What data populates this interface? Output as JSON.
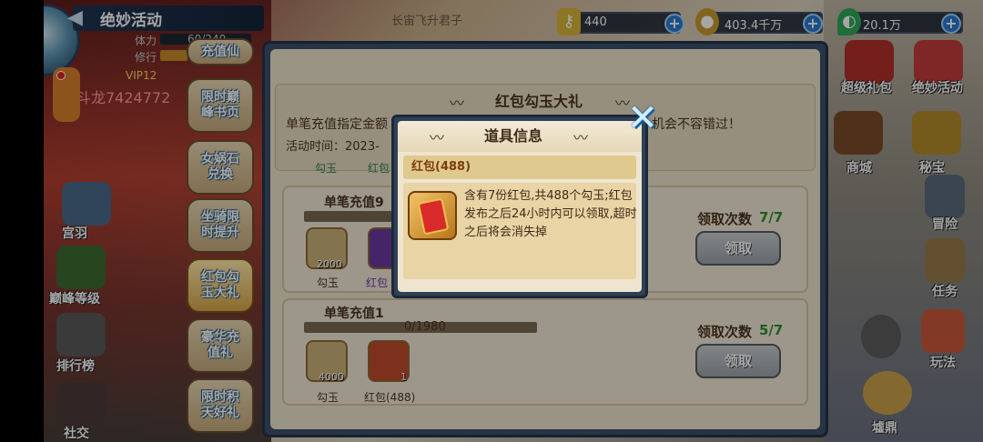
{
  "header": {
    "title": "绝妙活动",
    "stamina_label": "体力",
    "stamina_value": "60/240",
    "cultivation_label": "修行",
    "player_id": "斗龙7424772",
    "vip": "VIP12"
  },
  "resources": [
    {
      "icon": "key-icon",
      "value": "440"
    },
    {
      "icon": "coin-icon",
      "value": "403.4千万"
    },
    {
      "icon": "jade-icon",
      "value": "20.1万"
    }
  ],
  "top_center_text": "长宙飞升君子",
  "nav": {
    "items": [
      {
        "label": "限时巅峰书页"
      },
      {
        "label": "女娲石兑换"
      },
      {
        "label": "坐骑限时提升"
      },
      {
        "label": "红包勾玉大礼"
      },
      {
        "label": "豪华充值礼"
      },
      {
        "label": "限时积天好礼"
      }
    ],
    "top_partial": "充值仙"
  },
  "left_side": [
    {
      "label": "宫羽"
    },
    {
      "label": "巅峰等级"
    },
    {
      "label": "排行榜"
    },
    {
      "label": "社交"
    }
  ],
  "right_side": [
    {
      "label": "超级礼包"
    },
    {
      "label": "绝妙活动"
    },
    {
      "label": "商城"
    },
    {
      "label": "秘宝"
    },
    {
      "label": "冒险"
    },
    {
      "label": "任务"
    },
    {
      "label": "玩法"
    },
    {
      "label": "墟鼎"
    }
  ],
  "panel": {
    "title": "红包勾玉大礼",
    "desc_left": "单笔充值指定金额",
    "desc_right": "机会不容错过！",
    "time_label": "活动时间：2023-",
    "tag_1": "勾玉",
    "tag_2": "红包",
    "rows": [
      {
        "title": "单笔充值9",
        "progress_text": "",
        "count_label": "领取次数",
        "count_value": "7/7",
        "button": "领取",
        "items": [
          {
            "count": "2000",
            "name": "勾玉"
          },
          {
            "count": "",
            "name": "红包"
          }
        ]
      },
      {
        "title": "单笔充值1",
        "progress_text": "0/1980",
        "count_label": "领取次数",
        "count_value": "5/7",
        "button": "领取",
        "items": [
          {
            "count": "4000",
            "name": "勾玉"
          },
          {
            "count": "1",
            "name": "红包(488)"
          }
        ]
      }
    ]
  },
  "dialog": {
    "title": "道具信息",
    "item_name": "红包(488)",
    "description": "含有7份红包,共488个勾玉;红包发布之后24小时内可以领取,超时之后将会消失掉"
  },
  "colors": {
    "panel_frame": "#3b506b",
    "panel_bg": "#ede3cd",
    "count_green": "#2f8f2f",
    "nav_text_outline": "#2d5b7c"
  }
}
